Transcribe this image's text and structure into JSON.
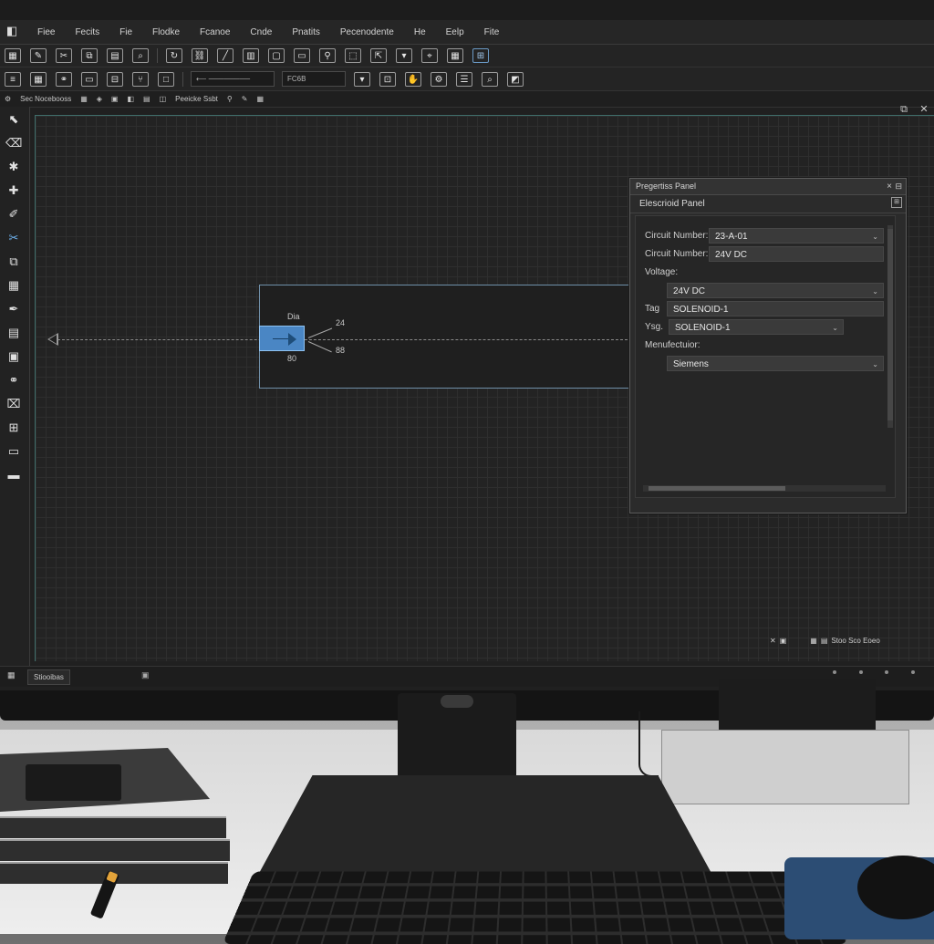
{
  "menu": [
    "Fiee",
    "Fecits",
    "Fie",
    "Flodke",
    "Fcanoe",
    "Cnde",
    "Pnatits",
    "Pecenodente",
    "He",
    "Eelp",
    "Fite"
  ],
  "toolbar3": {
    "field1": "Sec Nocebooss",
    "select2": "FC6B",
    "text3": "Peeicke Ssbt"
  },
  "properties": {
    "title": "Pregertiss Panel",
    "close": "×",
    "subtitle": "Elescrioid Panel",
    "rows": [
      {
        "label": "Circuit Number:",
        "value": "23-A-01",
        "dropdown": true
      },
      {
        "label": "Circuit Number:",
        "value": "24V DC",
        "dropdown": false
      },
      {
        "label": "Voltage:",
        "value": "",
        "dropdown": false
      },
      {
        "label": "",
        "value": "24V DC",
        "dropdown": true
      },
      {
        "label": "Tag",
        "value": "SOLENOID-1",
        "dropdown": false
      },
      {
        "label": "Ysg.",
        "value": "SOLENOID-1",
        "dropdown": true
      },
      {
        "label": "Menufectuior:",
        "value": "",
        "dropdown": false
      },
      {
        "label": "",
        "value": "Siemens",
        "dropdown": true
      }
    ]
  },
  "schematic": {
    "label_top": "Dia",
    "label_in": "24",
    "label_out": "88",
    "label_bottom": "80"
  },
  "status": {
    "sheet_tab": "Stiooibas",
    "canvas_status": "Stoo Sco Eoeo"
  },
  "colors": {
    "accent": "#4a86c4",
    "canvas": "#232323",
    "panel": "#2b2b2b"
  }
}
